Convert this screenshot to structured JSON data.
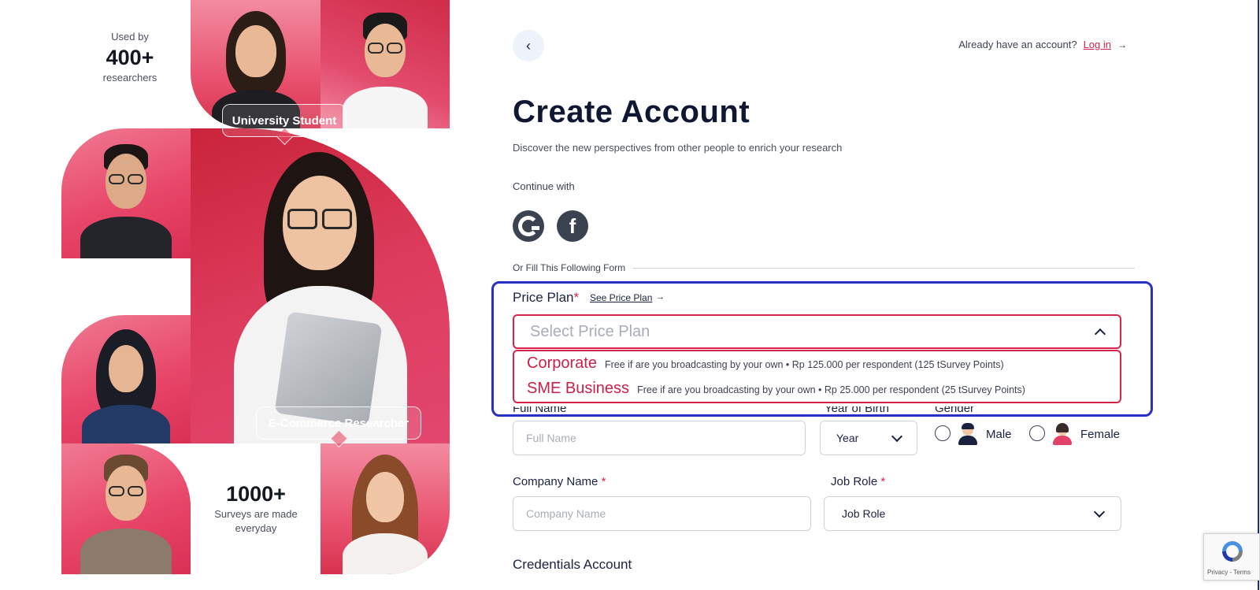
{
  "left": {
    "used_by_label": "Used by",
    "used_by_count": "400+",
    "used_by_unit": "researchers",
    "surveys_count": "1000+",
    "surveys_label_1": "Surveys are made",
    "surveys_label_2": "everyday",
    "bubble_top": "University Student",
    "bubble_bottom": "E-Commerce Researcher"
  },
  "header": {
    "back_icon": "chevron-left-icon",
    "login_prompt": "Already have an account?",
    "login_link": "Log in",
    "login_arrow": "→"
  },
  "main": {
    "title": "Create Account",
    "subtitle": "Discover the new perspectives from other people to enrich your research",
    "continue_with": "Continue with",
    "social": {
      "google": "google-icon",
      "facebook": "facebook-icon",
      "facebook_glyph": "f"
    },
    "divider_text": "Or Fill This Following Form"
  },
  "price_plan": {
    "label": "Price Plan",
    "required": "*",
    "see_link": "See Price Plan",
    "see_arrow": "→",
    "placeholder": "Select Price Plan",
    "options": [
      {
        "name": "Corporate",
        "desc": "Free if are you broadcasting by your own • Rp 125.000 per respondent (125 tSurvey Points)"
      },
      {
        "name": "SME Business",
        "desc": "Free if are you broadcasting by your own • Rp 25.000 per respondent (25 tSurvey Points)"
      }
    ]
  },
  "fields": {
    "full_name_label": "Full Name",
    "full_name_placeholder": "Full Name",
    "year_label": "Year of Birth",
    "year_value": "Year",
    "gender_label": "Gender",
    "gender_male": "Male",
    "gender_female": "Female",
    "company_label": "Company Name",
    "company_required": "*",
    "company_placeholder": "Company Name",
    "job_role_label": "Job Role",
    "job_role_required": "*",
    "job_role_value": "Job Role",
    "credentials_heading": "Credentials Account"
  },
  "recaptcha": {
    "terms": "Privacy - Terms"
  },
  "colors": {
    "accent": "#d8234a",
    "title": "#0f1733",
    "highlight": "#2a2fc4",
    "social": "#3b4250"
  }
}
